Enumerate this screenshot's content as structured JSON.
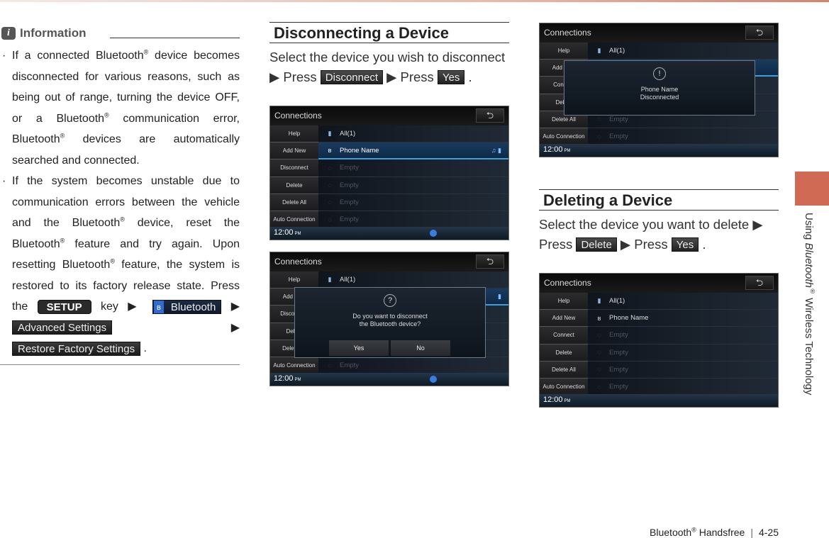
{
  "info": {
    "title": "Information",
    "icon": "info-icon",
    "bullet1": {
      "a": "If a connected Bluetooth",
      "b": " device becomes disconnected for various reasons, such as being out of range, turning the device OFF, or a Bluetooth",
      "c": " communication  error, Bluetooth",
      "d": " devices are automatically searched and connected."
    },
    "bullet2": {
      "a": "If the system becomes unstable due to communication errors between the vehicle and the Bluetooth",
      "b": " device, reset the Bluetooth",
      "c": " feature and try again. Upon resetting Bluetooth",
      "d": " feature, the system is restored to its factory release state. Press the ",
      "setup": "SETUP",
      "e": " key ▶ ",
      "bluetooth": "Bluetooth",
      "f": " ▶ ",
      "advanced": "Advanced Settings",
      "g": " ▶ ",
      "restore": "Restore Factory Settings",
      "h": " ."
    },
    "reg": "®"
  },
  "disconnect": {
    "heading": "Disconnecting a Device",
    "text1": "Select the device you wish to disconnect ▶ Press ",
    "btn1": "Disconnect",
    "text2": " ▶ Press ",
    "btn2": "Yes",
    "text3": " ."
  },
  "delete": {
    "heading": "Deleting a Device",
    "text1": "Select the device you want to delete ▶ Press ",
    "btn1": "Delete",
    "text2": " ▶ Press ",
    "btn2": "Yes",
    "text3": " ."
  },
  "screens": [
    {
      "title": "Connections",
      "back": "⮌",
      "menu": [
        "Help",
        "Add New",
        "Disconnect",
        "Delete",
        "Delete All",
        "Auto Connection"
      ],
      "rows": [
        {
          "label": "All(1)",
          "type": "head"
        },
        {
          "label": "Phone Name",
          "type": "sel",
          "right": "♫ ▮"
        },
        {
          "label": "Empty",
          "type": "empty"
        },
        {
          "label": "Empty",
          "type": "empty"
        },
        {
          "label": "Empty",
          "type": "empty"
        },
        {
          "label": "Empty",
          "type": "empty"
        }
      ],
      "time": "12:00",
      "ampm": "PM",
      "bt": true
    },
    {
      "title": "Connections",
      "back": "⮌",
      "menu": [
        "Help",
        "Add New",
        "Disconnect",
        "Delete",
        "Delete All",
        "Auto Connection"
      ],
      "rows": [
        {
          "label": "All(1)",
          "type": "head"
        },
        {
          "label": "Phone Name",
          "type": "sel",
          "right": "▮"
        },
        {
          "label": "Empty",
          "type": "empty"
        },
        {
          "label": "Empty",
          "type": "empty"
        },
        {
          "label": "Empty",
          "type": "empty"
        },
        {
          "label": "Empty",
          "type": "empty"
        }
      ],
      "time": "12:00",
      "ampm": "PM",
      "bt": true,
      "popup": {
        "icon": "?",
        "lines": [
          "Do you want to disconnect",
          "the Bluetooth device?"
        ],
        "buttons": [
          "Yes",
          "No"
        ]
      }
    },
    {
      "title": "Connections",
      "back": "⮌",
      "menu": [
        "Help",
        "Add New",
        "Connect",
        "Delete",
        "Delete All",
        "Auto Connection"
      ],
      "rows": [
        {
          "label": "All(1)",
          "type": "head"
        },
        {
          "label": "",
          "type": "sel"
        },
        {
          "label": "Empty",
          "type": "empty"
        },
        {
          "label": "Empty",
          "type": "empty"
        },
        {
          "label": "Empty",
          "type": "empty"
        },
        {
          "label": "Empty",
          "type": "empty"
        }
      ],
      "time": "12:00",
      "ampm": "PM",
      "bt": false,
      "popup": {
        "icon": "!",
        "lines": [
          "Phone Name",
          "Disconnected"
        ],
        "buttons": []
      }
    },
    {
      "title": "Connections",
      "back": "⮌",
      "menu": [
        "Help",
        "Add New",
        "Connect",
        "Delete",
        "Delete All",
        "Auto Connection"
      ],
      "rows": [
        {
          "label": "All(1)",
          "type": "head"
        },
        {
          "label": "Phone Name",
          "type": "normal"
        },
        {
          "label": "Empty",
          "type": "empty"
        },
        {
          "label": "Empty",
          "type": "empty"
        },
        {
          "label": "Empty",
          "type": "empty"
        },
        {
          "label": "Empty",
          "type": "empty"
        }
      ],
      "time": "12:00",
      "ampm": "PM",
      "bt": false
    }
  ],
  "side_tab": {
    "pre": "Using ",
    "italic": "Bluetooth",
    "reg": "®",
    "post": " Wireless Technology",
    "color": "#d06a55"
  },
  "footer": {
    "section": "Bluetooth",
    "reg": "®",
    "section2": " Handsfree",
    "sep": "|",
    "page": "4-25"
  }
}
